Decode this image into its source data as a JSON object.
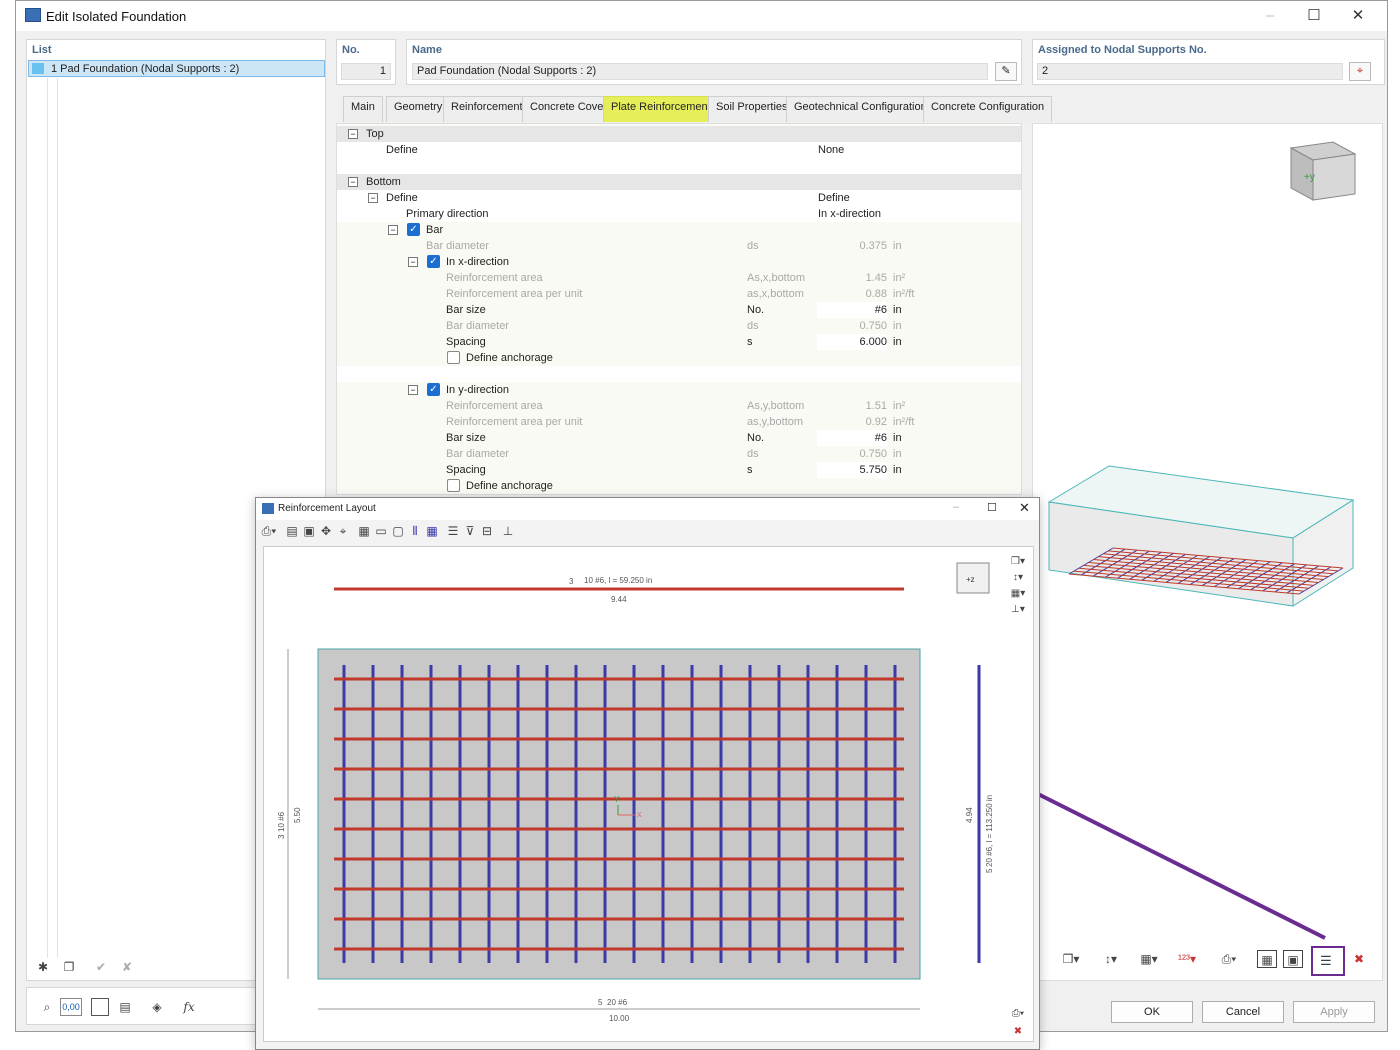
{
  "window": {
    "title": "Edit Isolated Foundation",
    "app_icon": "rfem-icon",
    "minimize": "–",
    "maximize": "☐",
    "close": "✕"
  },
  "list": {
    "header": "List",
    "items": [
      {
        "label": "1  Pad Foundation (Nodal Supports : 2)"
      }
    ]
  },
  "no": {
    "header": "No.",
    "value": "1"
  },
  "name": {
    "header": "Name",
    "value": "Pad Foundation (Nodal Supports : 2)"
  },
  "assigned": {
    "header": "Assigned to Nodal Supports No.",
    "value": "2"
  },
  "tabs": [
    "Main",
    "Geometry",
    "Reinforcement",
    "Concrete Cover",
    "Plate Reinforcement",
    "Soil Properties",
    "Geotechnical Configuration",
    "Concrete Configuration"
  ],
  "active_tab": "Plate Reinforcement",
  "grid": {
    "top": {
      "label": "Top",
      "define_label": "Define",
      "define_value": "None"
    },
    "bottom": {
      "label": "Bottom",
      "define_label": "Define",
      "define_value": "Define",
      "primary_label": "Primary direction",
      "primary_value": "In x-direction",
      "bar_label": "Bar",
      "bar_diameter": {
        "label": "Bar diameter",
        "symbol": "ds",
        "value": "0.375",
        "unit": "in"
      },
      "x": {
        "label": "In x-direction",
        "area": {
          "label": "Reinforcement area",
          "symbol": "As,x,bottom",
          "value": "1.45",
          "unit": "in²"
        },
        "area_unit": {
          "label": "Reinforcement area per unit",
          "symbol": "as,x,bottom",
          "value": "0.88",
          "unit": "in²/ft"
        },
        "size": {
          "label": "Bar size",
          "symbol": "No.",
          "value": "#6",
          "unit": "in"
        },
        "diam": {
          "label": "Bar diameter",
          "symbol": "ds",
          "value": "0.750",
          "unit": "in"
        },
        "spacing": {
          "label": "Spacing",
          "symbol": "s",
          "value": "6.000",
          "unit": "in"
        },
        "anchor": "Define anchorage"
      },
      "y": {
        "label": "In y-direction",
        "area": {
          "label": "Reinforcement area",
          "symbol": "As,y,bottom",
          "value": "1.51",
          "unit": "in²"
        },
        "area_unit": {
          "label": "Reinforcement area per unit",
          "symbol": "as,y,bottom",
          "value": "0.92",
          "unit": "in²/ft"
        },
        "size": {
          "label": "Bar size",
          "symbol": "No.",
          "value": "#6",
          "unit": "in"
        },
        "diam": {
          "label": "Bar diameter",
          "symbol": "ds",
          "value": "0.750",
          "unit": "in"
        },
        "spacing": {
          "label": "Spacing",
          "symbol": "s",
          "value": "5.750",
          "unit": "in"
        },
        "anchor": "Define anchorage"
      }
    }
  },
  "buttons": {
    "ok": "OK",
    "cancel": "Cancel",
    "apply": "Apply"
  },
  "bottom_tools": {
    "value_display": "0,00"
  },
  "layout_window": {
    "title": "Reinforcement Layout",
    "top_bar": {
      "mark": "3",
      "label": "10 #6, l = 59.250 in",
      "dim": "9.44"
    },
    "right_bar": {
      "mark": "5",
      "label": "20 #6, l = 113.250 in",
      "dim": "4.94"
    },
    "left_dim": {
      "mark": "3",
      "label": "10 #6",
      "dim": "5.50"
    },
    "bottom_dim": {
      "mark": "5",
      "label": "20 #6",
      "dim": "10.00"
    },
    "view_cube": "+z",
    "axis_y": "Y",
    "axis_x": "X"
  },
  "view_cube_3d": "+y",
  "colors": {
    "accent_tab": "#e6ef5a",
    "bar_x": "#c0392b",
    "bar_y": "#3a3aa8",
    "highlight": "#6a2c91"
  }
}
